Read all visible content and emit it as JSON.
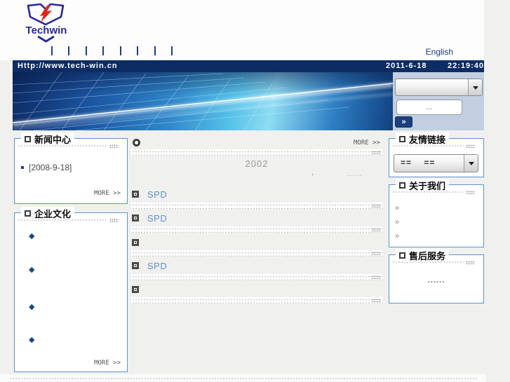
{
  "header": {
    "logo": {
      "text": "Techwin"
    },
    "nav": {
      "separator": "|"
    },
    "english_link": "English"
  },
  "url_bar": {
    "url": "Http://www.tech-win.cn",
    "date": "2011-6-18",
    "time": "22:19:40"
  },
  "banner": {
    "search_value": "...",
    "go_label": "»"
  },
  "left": {
    "news": {
      "title": "新闻中心",
      "item": "[2008-9-18]",
      "more": "MORE >>"
    },
    "culture": {
      "title": "企业文化",
      "bullet": "◆",
      "more": "MORE >>"
    }
  },
  "center": {
    "more": "MORE >>",
    "year": "2002",
    "comma": ",",
    "ellipsis": "......",
    "rows": [
      {
        "label": "SPD"
      },
      {
        "label": "SPD"
      },
      {
        "label": ""
      },
      {
        "label": "SPD"
      },
      {
        "label": ""
      }
    ]
  },
  "right": {
    "links": {
      "title": "友情链接",
      "selected": "==    =="
    },
    "about": {
      "title": "关于我们",
      "items": [
        "»",
        "»",
        "»"
      ]
    },
    "service": {
      "title": "售后服务",
      "text": "......"
    }
  },
  "colors": {
    "navy_bar": "#0d2c63",
    "box_border": "#5e93cc",
    "link_blue": "#6191cb",
    "logo_blue": "#28289b",
    "logo_red": "#e2251b",
    "panel_blue": "#c2cfe0"
  }
}
